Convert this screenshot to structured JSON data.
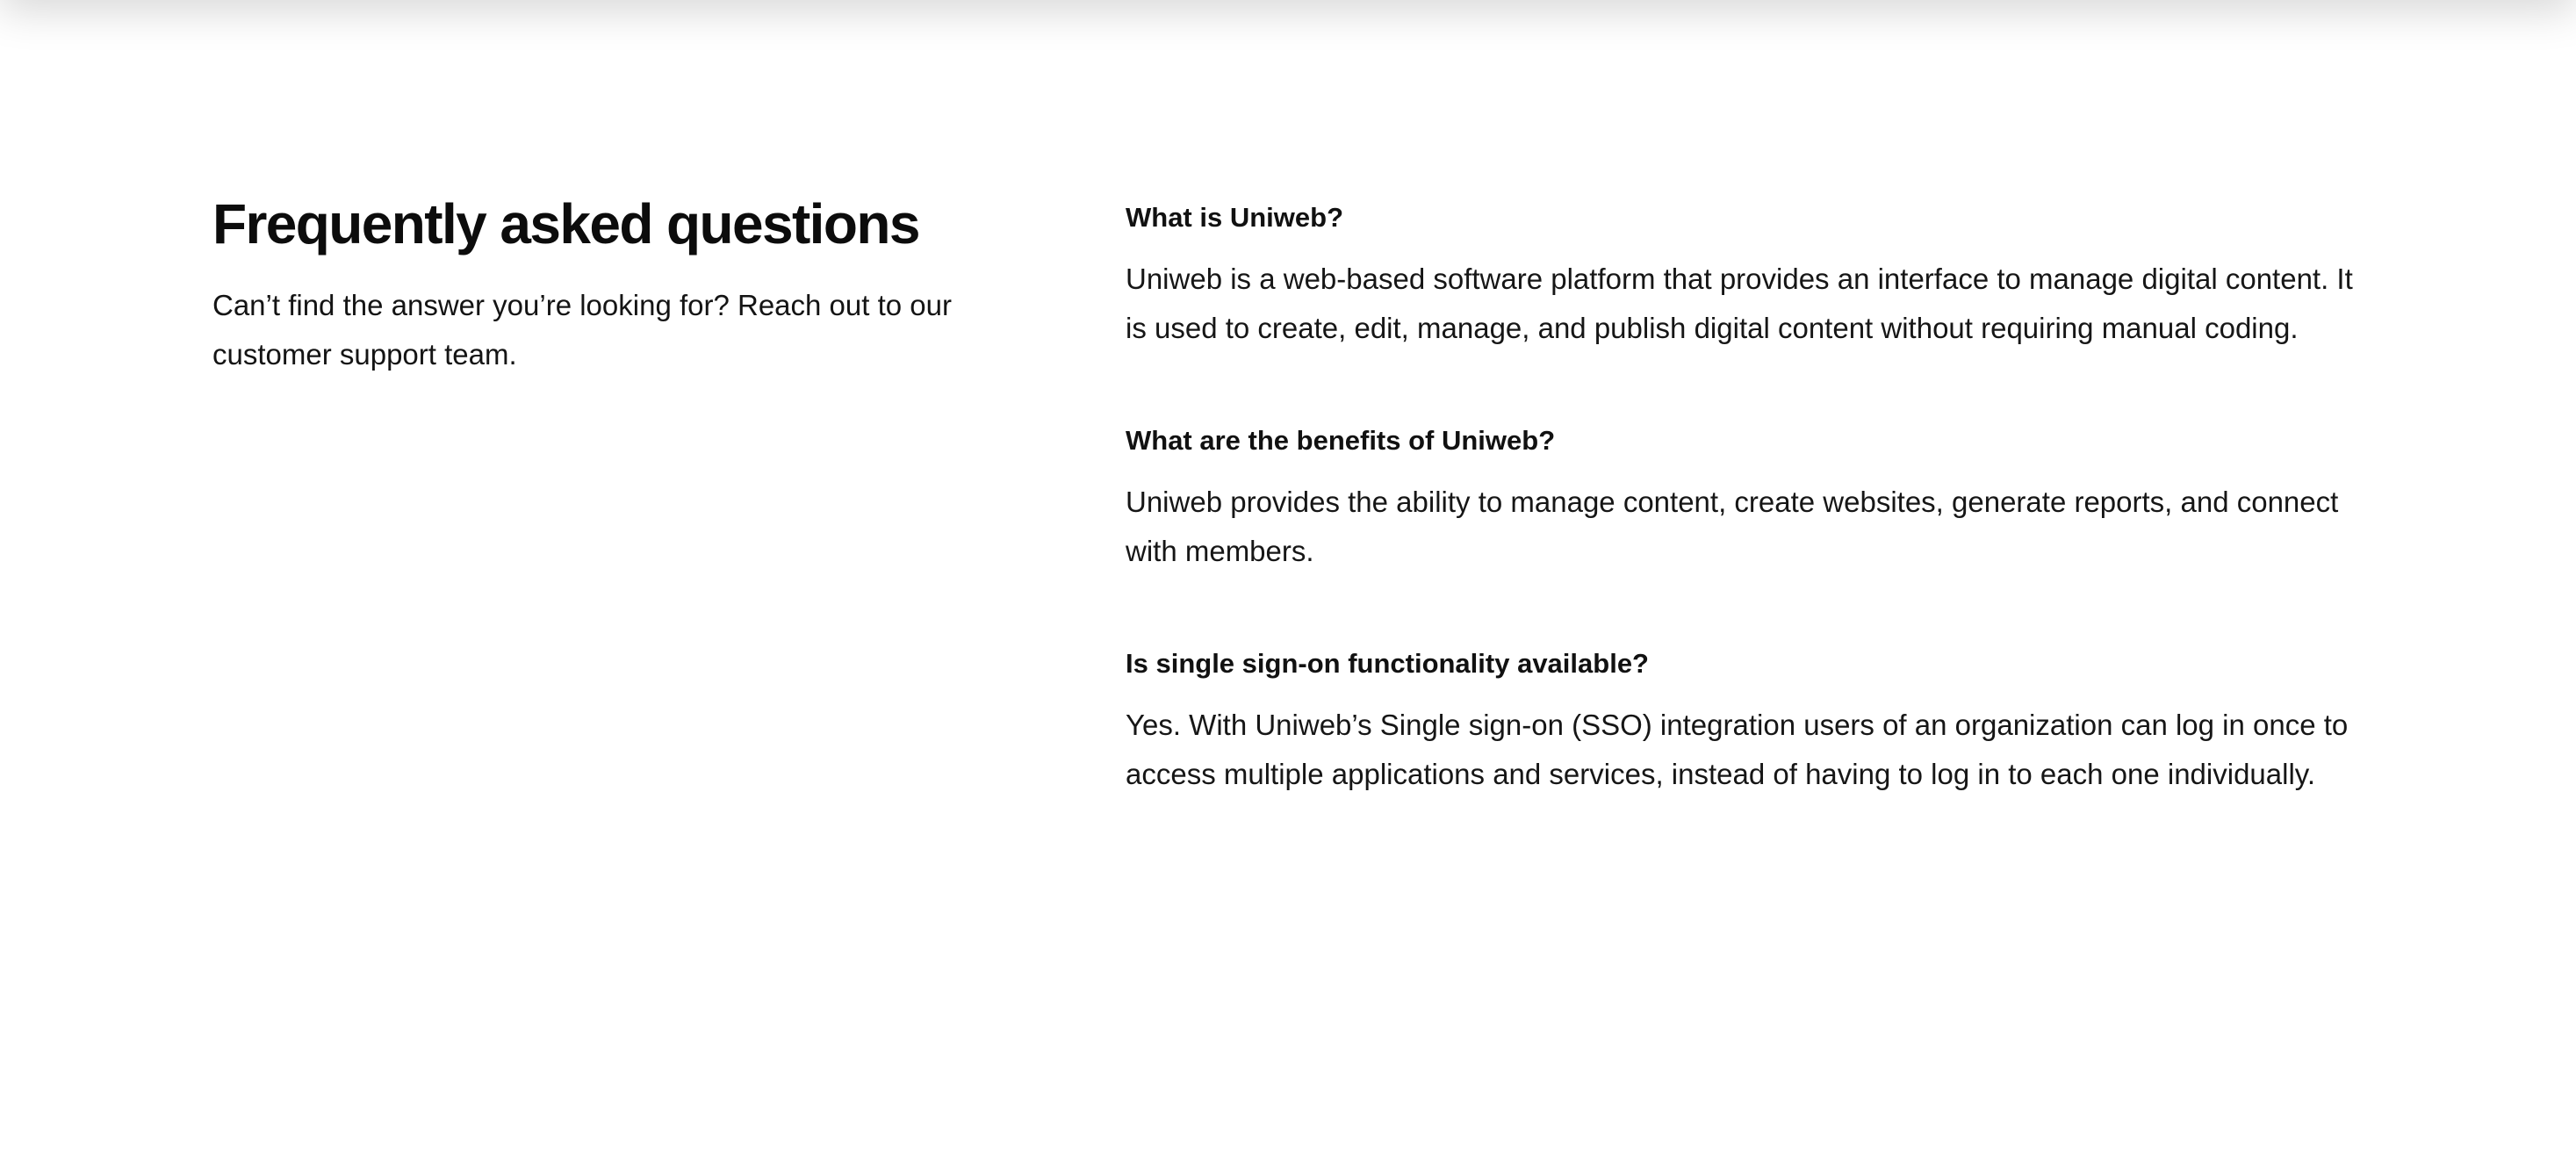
{
  "intro": {
    "title": "Frequently asked questions",
    "subtitle": "Can’t find the answer you’re looking for? Reach out to our customer support team."
  },
  "faqs": [
    {
      "question": "What is Uniweb?",
      "answer": "Uniweb is a web-based software platform that provides an interface to manage digital content. It is used to create, edit, manage, and publish digital content without requiring manual coding."
    },
    {
      "question": "What are the benefits of Uniweb?",
      "answer": "Uniweb provides the ability to manage content, create websites, generate reports, and connect with members."
    },
    {
      "question": "Is single sign-on functionality available?",
      "answer": "Yes. With Uniweb’s Single sign-on (SSO) integration users of an organization can log in once to access multiple applications and services, instead of having to log in to each one individually."
    }
  ]
}
